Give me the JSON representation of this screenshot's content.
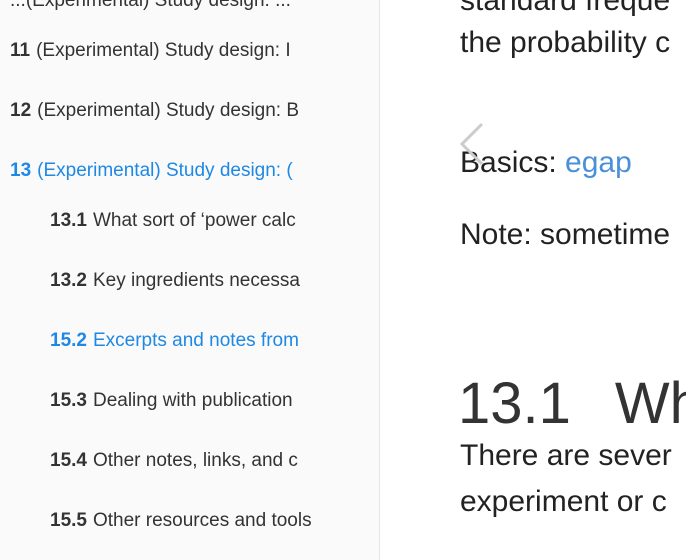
{
  "sidebar": {
    "partial_top": "...(Experimental) Study design: ...",
    "items": [
      {
        "num": "11",
        "label": "(Experimental) Study design: I",
        "active": false
      },
      {
        "num": "12",
        "label": "(Experimental) Study design: B",
        "active": false
      },
      {
        "num": "13",
        "label": "(Experimental) Study design: (",
        "active": true
      },
      {
        "num": "13.1",
        "label": "What sort of ‘power calc",
        "active": false
      },
      {
        "num": "13.2",
        "label": "Key ingredients necessa",
        "active": false
      },
      {
        "num": "15.2",
        "label": "Excerpts and notes from",
        "active": true
      },
      {
        "num": "15.3",
        "label": "Dealing with publication",
        "active": false
      },
      {
        "num": "15.4",
        "label": "Other notes, links, and c",
        "active": false
      },
      {
        "num": "15.5",
        "label": "Other resources and tools",
        "active": false
      }
    ]
  },
  "content": {
    "line1": "standard freque",
    "line2": "the probability c",
    "basics_label": "Basics:",
    "basics_link": "egap",
    "note": "Note: sometime",
    "heading_num": "13.1",
    "heading_text": "Wh",
    "para1_line1": "There are sever",
    "para1_line2": "experiment or c"
  },
  "colors": {
    "active": "#1e88e5",
    "link": "#4a90d9",
    "sidebar_bg": "#fafafa",
    "text": "#333333"
  },
  "icons": {
    "prev": "chevron-left-icon"
  }
}
